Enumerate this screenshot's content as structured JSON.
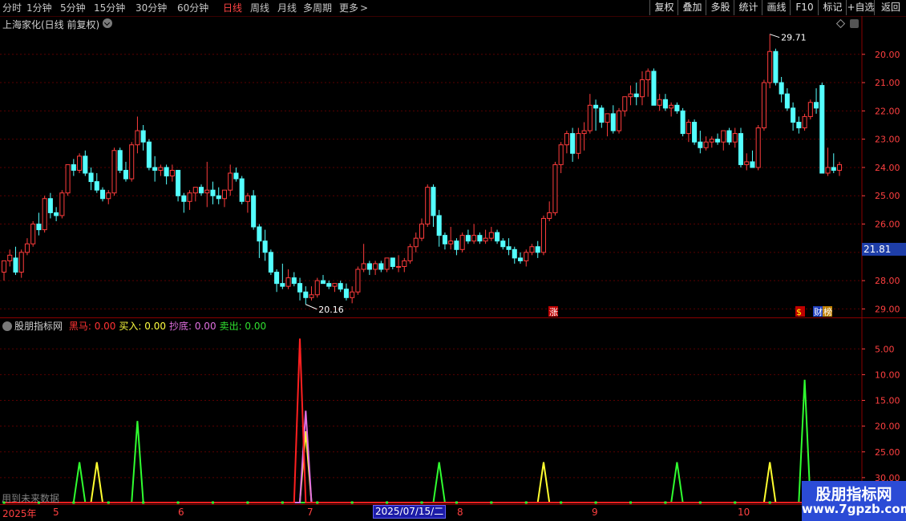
{
  "toolbar": {
    "periods": [
      {
        "label": "分时",
        "active": false
      },
      {
        "label": "1分钟",
        "active": false
      },
      {
        "label": "5分钟",
        "active": false
      },
      {
        "label": "15分钟",
        "active": false
      },
      {
        "label": "30分钟",
        "active": false
      },
      {
        "label": "60分钟",
        "active": false
      },
      {
        "label": "日线",
        "active": true
      },
      {
        "label": "周线",
        "active": false
      },
      {
        "label": "月线",
        "active": false
      },
      {
        "label": "多周期",
        "active": false
      },
      {
        "label": "更多",
        "active": false
      }
    ],
    "buttons": [
      "复权",
      "叠加",
      "多股",
      "统计",
      "画线",
      "F10",
      "标记",
      "+自选",
      "返回"
    ]
  },
  "main_chart": {
    "title": "上海家化(日线 前复权)",
    "current_price": "21.81",
    "high_label": "29.71",
    "low_label": "20.16",
    "y_ticks": [
      "29.00",
      "28.00",
      "27.00",
      "26.00",
      "25.00",
      "24.00",
      "23.00",
      "22.00",
      "21.00",
      "20.00"
    ],
    "badges": [
      "涨",
      "$",
      "财",
      "榜"
    ]
  },
  "indicator": {
    "name": "股朋指标网",
    "items": [
      {
        "label": "黑马:",
        "value": "0.00",
        "color": "#ff3333"
      },
      {
        "label": "买入:",
        "value": "0.00",
        "color": "#ffff40"
      },
      {
        "label": "抄底:",
        "value": "0.00",
        "color": "#e070e0"
      },
      {
        "label": "卖出:",
        "value": "0.00",
        "color": "#30e030"
      }
    ],
    "y_ticks": [
      "30.00",
      "25.00",
      "20.00",
      "15.00",
      "10.00",
      "5.00"
    ],
    "future_note": "用到未来数据"
  },
  "date_axis": {
    "year": "2025年",
    "months": [
      "5",
      "6",
      "7",
      "8",
      "9",
      "10"
    ],
    "cursor_date": "2025/07/15/二"
  },
  "watermark": {
    "line1": "股朋指标网",
    "line2": "www.7gpzb.com"
  },
  "colors": {
    "up": "#ff3c3c",
    "down": "#54ffff",
    "grid": "#5a0000",
    "axis": "#ff4040"
  },
  "chart_data": [
    {
      "type": "candlestick",
      "title": "上海家化(日线 前复权)",
      "ylim": [
        19.7,
        29.9
      ],
      "y_ticks": [
        20,
        21,
        22,
        23,
        24,
        25,
        26,
        27,
        28,
        29
      ],
      "candles": [
        [
          21.3,
          21.7,
          21.0,
          21.7
        ],
        [
          21.7,
          22.1,
          21.5,
          21.9
        ],
        [
          21.8,
          22.2,
          21.2,
          21.3
        ],
        [
          21.3,
          22.1,
          21.1,
          22.0
        ],
        [
          22.0,
          22.5,
          21.9,
          22.3
        ],
        [
          22.3,
          23.1,
          22.2,
          23.0
        ],
        [
          23.0,
          23.4,
          22.6,
          22.8
        ],
        [
          22.8,
          24.0,
          22.7,
          23.9
        ],
        [
          23.9,
          24.1,
          23.2,
          23.4
        ],
        [
          23.4,
          23.6,
          23.1,
          23.3
        ],
        [
          23.3,
          24.2,
          23.2,
          24.1
        ],
        [
          24.1,
          25.1,
          24.0,
          25.1
        ],
        [
          25.1,
          25.3,
          24.7,
          24.9
        ],
        [
          24.9,
          25.5,
          24.8,
          25.4
        ],
        [
          25.4,
          25.6,
          24.7,
          24.8
        ],
        [
          24.8,
          25.0,
          24.2,
          24.5
        ],
        [
          24.5,
          24.8,
          24.1,
          24.2
        ],
        [
          24.2,
          24.3,
          23.8,
          23.9
        ],
        [
          23.9,
          24.2,
          23.7,
          24.1
        ],
        [
          24.1,
          25.7,
          24.0,
          25.6
        ],
        [
          25.6,
          25.7,
          24.8,
          24.9
        ],
        [
          24.9,
          25.2,
          24.5,
          24.6
        ],
        [
          24.6,
          25.9,
          24.5,
          25.8
        ],
        [
          25.8,
          26.8,
          25.5,
          26.3
        ],
        [
          26.3,
          26.5,
          25.6,
          25.9
        ],
        [
          25.9,
          26.0,
          24.9,
          25.0
        ],
        [
          25.0,
          25.4,
          24.5,
          24.9
        ],
        [
          24.9,
          25.1,
          24.7,
          25.0
        ],
        [
          25.0,
          25.1,
          24.4,
          24.7
        ],
        [
          24.7,
          25.1,
          24.5,
          24.9
        ],
        [
          24.9,
          24.9,
          23.8,
          24.0
        ],
        [
          24.0,
          24.1,
          23.4,
          23.8
        ],
        [
          23.8,
          24.2,
          23.5,
          24.1
        ],
        [
          24.1,
          24.3,
          23.8,
          24.3
        ],
        [
          24.3,
          24.4,
          24.0,
          24.1
        ],
        [
          24.1,
          25.2,
          23.6,
          24.2
        ],
        [
          24.2,
          24.5,
          23.7,
          24.0
        ],
        [
          24.0,
          24.3,
          23.7,
          23.9
        ],
        [
          23.9,
          24.2,
          23.6,
          24.2
        ],
        [
          24.2,
          25.1,
          24.0,
          24.8
        ],
        [
          24.8,
          25.0,
          24.5,
          24.6
        ],
        [
          24.6,
          24.7,
          23.7,
          23.8
        ],
        [
          23.8,
          24.1,
          23.4,
          24.0
        ],
        [
          24.0,
          24.2,
          22.8,
          22.9
        ],
        [
          22.9,
          23.0,
          21.8,
          22.4
        ],
        [
          22.4,
          22.8,
          21.7,
          22.0
        ],
        [
          22.0,
          22.1,
          21.2,
          21.3
        ],
        [
          21.3,
          21.4,
          20.6,
          20.9
        ],
        [
          20.9,
          21.6,
          20.7,
          20.8
        ],
        [
          20.8,
          21.4,
          20.7,
          21.1
        ],
        [
          21.1,
          21.3,
          20.8,
          20.9
        ],
        [
          20.9,
          21.1,
          20.3,
          20.6
        ],
        [
          20.6,
          20.8,
          20.16,
          20.4
        ],
        [
          20.4,
          20.8,
          20.3,
          20.5
        ],
        [
          20.5,
          21.1,
          20.4,
          21.0
        ],
        [
          21.0,
          21.2,
          20.9,
          20.9
        ],
        [
          20.9,
          21.0,
          20.7,
          20.8
        ],
        [
          20.8,
          20.9,
          20.6,
          20.9
        ],
        [
          20.9,
          21.0,
          20.6,
          20.7
        ],
        [
          20.7,
          20.9,
          20.3,
          20.4
        ],
        [
          20.4,
          20.8,
          20.2,
          20.6
        ],
        [
          20.6,
          21.5,
          20.5,
          21.4
        ],
        [
          21.4,
          22.3,
          21.3,
          21.6
        ],
        [
          21.6,
          21.7,
          21.2,
          21.4
        ],
        [
          21.4,
          21.7,
          21.2,
          21.6
        ],
        [
          21.6,
          21.7,
          21.3,
          21.4
        ],
        [
          21.4,
          21.8,
          21.3,
          21.8
        ],
        [
          21.8,
          21.8,
          21.4,
          21.5
        ],
        [
          21.5,
          21.9,
          21.3,
          21.5
        ],
        [
          21.5,
          21.8,
          21.3,
          21.7
        ],
        [
          21.7,
          22.3,
          21.6,
          22.2
        ],
        [
          22.2,
          22.7,
          22.0,
          22.5
        ],
        [
          22.5,
          23.2,
          22.4,
          23.0
        ],
        [
          23.0,
          24.4,
          22.9,
          24.3
        ],
        [
          24.3,
          24.4,
          22.9,
          23.3
        ],
        [
          23.3,
          23.5,
          22.2,
          22.6
        ],
        [
          22.6,
          22.7,
          22.1,
          22.3
        ],
        [
          22.3,
          22.9,
          22.1,
          22.4
        ],
        [
          22.4,
          22.5,
          21.9,
          22.1
        ],
        [
          22.1,
          22.7,
          22.0,
          22.6
        ],
        [
          22.6,
          22.8,
          22.3,
          22.4
        ],
        [
          22.4,
          23.0,
          22.3,
          22.6
        ],
        [
          22.6,
          22.7,
          22.3,
          22.4
        ],
        [
          22.4,
          22.8,
          22.3,
          22.5
        ],
        [
          22.5,
          22.9,
          22.4,
          22.7
        ],
        [
          22.7,
          22.8,
          22.3,
          22.4
        ],
        [
          22.4,
          22.5,
          22.1,
          22.2
        ],
        [
          22.2,
          22.5,
          21.9,
          22.1
        ],
        [
          22.1,
          22.2,
          21.6,
          21.8
        ],
        [
          21.8,
          22.0,
          21.6,
          21.7
        ],
        [
          21.7,
          22.1,
          21.5,
          22.0
        ],
        [
          22.0,
          22.3,
          21.9,
          22.2
        ],
        [
          22.2,
          22.4,
          21.8,
          22.0
        ],
        [
          22.0,
          23.3,
          21.9,
          23.2
        ],
        [
          23.2,
          23.8,
          23.1,
          23.4
        ],
        [
          23.4,
          25.2,
          23.3,
          25.1
        ],
        [
          25.1,
          25.9,
          24.8,
          25.8
        ],
        [
          25.8,
          26.3,
          25.5,
          26.2
        ],
        [
          26.2,
          26.4,
          25.2,
          25.5
        ],
        [
          25.5,
          26.4,
          25.3,
          26.2
        ],
        [
          26.2,
          26.6,
          25.6,
          26.3
        ],
        [
          26.3,
          27.6,
          26.2,
          27.2
        ],
        [
          27.2,
          27.4,
          26.3,
          27.1
        ],
        [
          27.1,
          27.2,
          26.4,
          26.6
        ],
        [
          26.6,
          26.9,
          26.1,
          26.9
        ],
        [
          26.9,
          27.2,
          26.2,
          26.3
        ],
        [
          26.3,
          27.1,
          26.2,
          27.0
        ],
        [
          27.0,
          27.5,
          26.8,
          27.5
        ],
        [
          27.5,
          27.9,
          27.2,
          27.6
        ],
        [
          27.6,
          28.0,
          27.2,
          27.5
        ],
        [
          27.5,
          28.4,
          27.2,
          28.1
        ],
        [
          28.1,
          28.5,
          27.5,
          28.4
        ],
        [
          28.4,
          28.5,
          27.2,
          27.2
        ],
        [
          27.2,
          27.6,
          27.0,
          27.4
        ],
        [
          27.4,
          27.6,
          27.0,
          27.1
        ],
        [
          27.1,
          27.3,
          26.8,
          27.2
        ],
        [
          27.2,
          27.3,
          26.9,
          27.0
        ],
        [
          27.0,
          27.1,
          26.1,
          26.2
        ],
        [
          26.2,
          26.7,
          25.9,
          26.6
        ],
        [
          26.6,
          26.7,
          25.8,
          25.9
        ],
        [
          25.9,
          26.3,
          25.5,
          25.7
        ],
        [
          25.7,
          26.1,
          25.6,
          25.9
        ],
        [
          25.9,
          26.1,
          25.7,
          26.0
        ],
        [
          26.0,
          26.2,
          25.8,
          25.9
        ],
        [
          25.9,
          26.3,
          25.6,
          26.3
        ],
        [
          26.3,
          26.4,
          25.8,
          25.9
        ],
        [
          25.9,
          26.4,
          25.7,
          26.2
        ],
        [
          26.2,
          26.4,
          25.0,
          25.1
        ],
        [
          25.1,
          25.5,
          24.9,
          25.2
        ],
        [
          25.2,
          25.6,
          25.0,
          25.0
        ],
        [
          25.0,
          26.5,
          24.9,
          26.4
        ],
        [
          26.4,
          28.1,
          26.3,
          28.0
        ],
        [
          28.0,
          29.71,
          27.8,
          29.1
        ],
        [
          29.1,
          29.2,
          27.9,
          28.0
        ],
        [
          28.0,
          28.2,
          27.3,
          27.6
        ],
        [
          27.6,
          27.8,
          27.0,
          27.1
        ],
        [
          27.1,
          27.3,
          26.3,
          26.6
        ],
        [
          26.6,
          26.8,
          26.2,
          26.4
        ],
        [
          26.4,
          26.9,
          26.3,
          26.8
        ],
        [
          26.8,
          27.4,
          26.7,
          27.3
        ],
        [
          27.3,
          27.8,
          26.9,
          27.1
        ],
        [
          27.9,
          28.0,
          24.8,
          24.8
        ],
        [
          24.8,
          25.7,
          24.7,
          25.0
        ],
        [
          25.0,
          25.5,
          24.8,
          24.9
        ],
        [
          24.9,
          25.2,
          24.7,
          25.1
        ]
      ]
    },
    {
      "type": "line",
      "title": "股朋指标网",
      "ylim": [
        0,
        33
      ],
      "y_ticks": [
        5,
        10,
        15,
        20,
        25,
        30
      ],
      "series": [
        {
          "name": "黑马",
          "color": "#ff2020",
          "spikes": [
            {
              "at": 51,
              "value": 32
            }
          ]
        },
        {
          "name": "买入",
          "color": "#ffff30",
          "spikes": [
            {
              "at": 16,
              "value": 8
            },
            {
              "at": 52,
              "value": 14
            },
            {
              "at": 93,
              "value": 8
            },
            {
              "at": 132,
              "value": 8
            },
            {
              "at": 147,
              "value": 8
            }
          ]
        },
        {
          "name": "抄底",
          "color": "#e070e0",
          "spikes": [
            {
              "at": 52,
              "value": 18
            }
          ]
        },
        {
          "name": "卖出",
          "color": "#30ff30",
          "spikes": [
            {
              "at": 13,
              "value": 8
            },
            {
              "at": 23,
              "value": 16
            },
            {
              "at": 75,
              "value": 8
            },
            {
              "at": 116,
              "value": 8
            },
            {
              "at": 138,
              "value": 24
            }
          ]
        }
      ]
    }
  ]
}
